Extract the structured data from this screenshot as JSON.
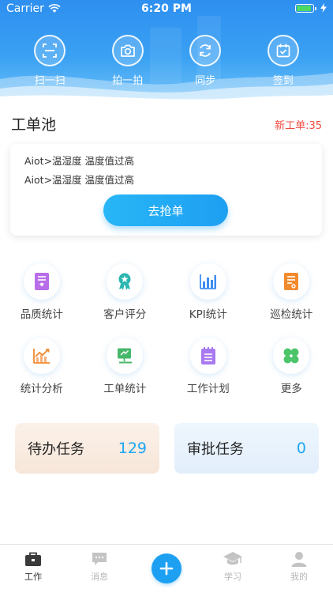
{
  "status_bar": {
    "carrier": "Carrier",
    "time": "6:20 PM"
  },
  "quick_actions": [
    {
      "label": "扫一扫",
      "icon": "scan-icon"
    },
    {
      "label": "拍一拍",
      "icon": "camera-icon"
    },
    {
      "label": "同步",
      "icon": "sync-icon"
    },
    {
      "label": "签到",
      "icon": "checkin-icon"
    }
  ],
  "pool": {
    "title": "工单池",
    "new_label": "新工单:35",
    "alarms": [
      "Aiot>温湿度 温度值过高",
      "Aiot>温湿度 温度值过高"
    ],
    "grab_label": "去抢单"
  },
  "grid": [
    {
      "label": "品质统计",
      "icon": "quality-icon",
      "color": "#b86ee8"
    },
    {
      "label": "客户评分",
      "icon": "award-icon",
      "color": "#2bb6b0"
    },
    {
      "label": "KPI统计",
      "icon": "bar-chart-icon",
      "color": "#3d8df0"
    },
    {
      "label": "巡检统计",
      "icon": "inspection-icon",
      "color": "#f28a2e"
    },
    {
      "label": "统计分析",
      "icon": "trend-chart-icon",
      "color": "#f28a2e"
    },
    {
      "label": "工单统计",
      "icon": "monitor-icon",
      "color": "#46b86a"
    },
    {
      "label": "工作计划",
      "icon": "plan-icon",
      "color": "#a87af0"
    },
    {
      "label": "更多",
      "icon": "clover-icon",
      "color": "#4cc46a"
    }
  ],
  "tasks": {
    "todo": {
      "title": "待办任务",
      "count": "129"
    },
    "approve": {
      "title": "审批任务",
      "count": "0"
    }
  },
  "tabbar": [
    {
      "label": "工作",
      "icon": "briefcase-icon"
    },
    {
      "label": "消息",
      "icon": "message-icon"
    },
    {
      "label": "学习",
      "icon": "graduation-cap-icon"
    },
    {
      "label": "我的",
      "icon": "user-icon"
    }
  ]
}
